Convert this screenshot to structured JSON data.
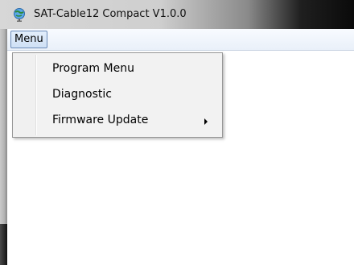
{
  "window": {
    "title": "SAT-Cable12 Compact V1.0.0"
  },
  "menubar": {
    "menu_label": "Menu"
  },
  "menu": {
    "items": [
      {
        "label": "Program Menu",
        "has_submenu": false
      },
      {
        "label": "Diagnostic",
        "has_submenu": false
      },
      {
        "label": "Firmware Update",
        "has_submenu": true
      }
    ]
  },
  "icons": {
    "app": "app-globe-icon",
    "submenu": "submenu-arrow-icon"
  },
  "colors": {
    "menu_button_border": "#6b8bb8",
    "menu_background": "#f2f2f2"
  }
}
